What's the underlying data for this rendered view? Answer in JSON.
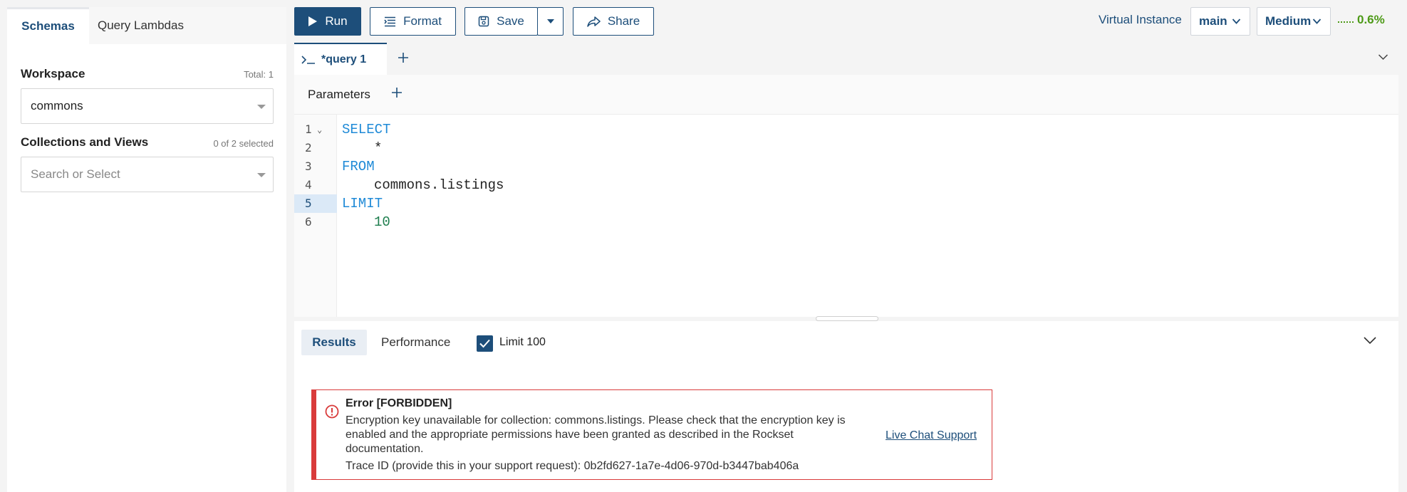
{
  "left_panel": {
    "tabs": [
      {
        "label": "Schemas",
        "active": true
      },
      {
        "label": "Query Lambdas",
        "active": false
      }
    ],
    "workspace": {
      "label": "Workspace",
      "meta": "Total: 1",
      "value": "commons"
    },
    "collections": {
      "label": "Collections and Views",
      "meta": "0 of 2 selected",
      "placeholder": "Search or Select"
    }
  },
  "toolbar": {
    "run_label": "Run",
    "format_label": "Format",
    "save_label": "Save",
    "share_label": "Share",
    "virtual_instance_label": "Virtual Instance",
    "instance_value": "main",
    "size_value": "Medium",
    "usage_percent": "0.6%"
  },
  "query_tabs": {
    "active_label": "*query 1"
  },
  "parameters": {
    "label": "Parameters"
  },
  "editor": {
    "active_line": 5,
    "lines": [
      {
        "num": "1",
        "text": "SELECT",
        "kind": "keyword",
        "indent": 0
      },
      {
        "num": "2",
        "text": "*",
        "kind": "plain",
        "indent": 1
      },
      {
        "num": "3",
        "text": "FROM",
        "kind": "keyword",
        "indent": 0
      },
      {
        "num": "4",
        "text": "commons.listings",
        "kind": "plain",
        "indent": 1
      },
      {
        "num": "5",
        "text": "LIMIT",
        "kind": "keyword",
        "indent": 0
      },
      {
        "num": "6",
        "text": "10",
        "kind": "number",
        "indent": 1
      }
    ]
  },
  "results": {
    "tabs": [
      {
        "label": "Results",
        "active": true
      },
      {
        "label": "Performance",
        "active": false
      }
    ],
    "limit_label": "Limit 100",
    "limit_checked": true,
    "error": {
      "title": "Error [FORBIDDEN]",
      "message": "Encryption key unavailable for collection: commons.listings. Please check that the encryption key is enabled and the appropriate permissions have been granted as described in the Rockset documentation.",
      "trace": "Trace ID (provide this in your support request): 0b2fd627-1a7e-4d06-970d-b3447bab406a",
      "link_label": "Live Chat Support"
    }
  },
  "colors": {
    "brand": "#1d4e7a",
    "keyword": "#1f8ad7",
    "error": "#d93b3b",
    "usage": "#4d9a17"
  },
  "icons": [
    "play-icon",
    "format-icon",
    "save-icon",
    "chevron-down-icon",
    "share-icon",
    "terminal-icon",
    "plus-icon",
    "error-icon",
    "check-icon"
  ]
}
